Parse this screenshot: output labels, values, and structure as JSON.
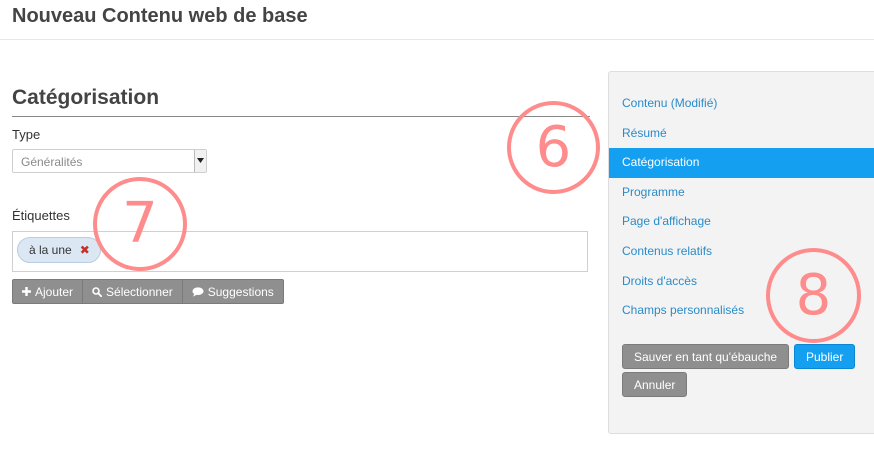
{
  "header": {
    "title": "Nouveau Contenu web de base"
  },
  "section": {
    "title": "Catégorisation"
  },
  "type_field": {
    "label": "Type",
    "value": "Généralités"
  },
  "tags_field": {
    "label": "Étiquettes",
    "tags": [
      {
        "label": "à la une"
      }
    ],
    "remove_glyph": "✖"
  },
  "tag_buttons": {
    "add": "Ajouter",
    "select": "Sélectionner",
    "suggestions": "Suggestions"
  },
  "sidebar": {
    "items": [
      {
        "label": "Contenu (Modifié)",
        "active": false
      },
      {
        "label": "Résumé",
        "active": false
      },
      {
        "label": "Catégorisation",
        "active": true
      },
      {
        "label": "Programme",
        "active": false
      },
      {
        "label": "Page d'affichage",
        "active": false
      },
      {
        "label": "Contenus relatifs",
        "active": false
      },
      {
        "label": "Droits d'accès",
        "active": false
      },
      {
        "label": "Champs personnalisés",
        "active": false
      }
    ],
    "save_draft": "Sauver en tant qu'ébauche",
    "publish": "Publier",
    "cancel": "Annuler"
  },
  "callouts": [
    "6",
    "7",
    "8"
  ],
  "colors": {
    "accent": "#159ff1",
    "link": "#2a8bc9",
    "button_gray": "#8f8f8f",
    "callout": "#ff8c8c",
    "tag_bg": "#dbe8f4",
    "remove": "#c0332b"
  }
}
